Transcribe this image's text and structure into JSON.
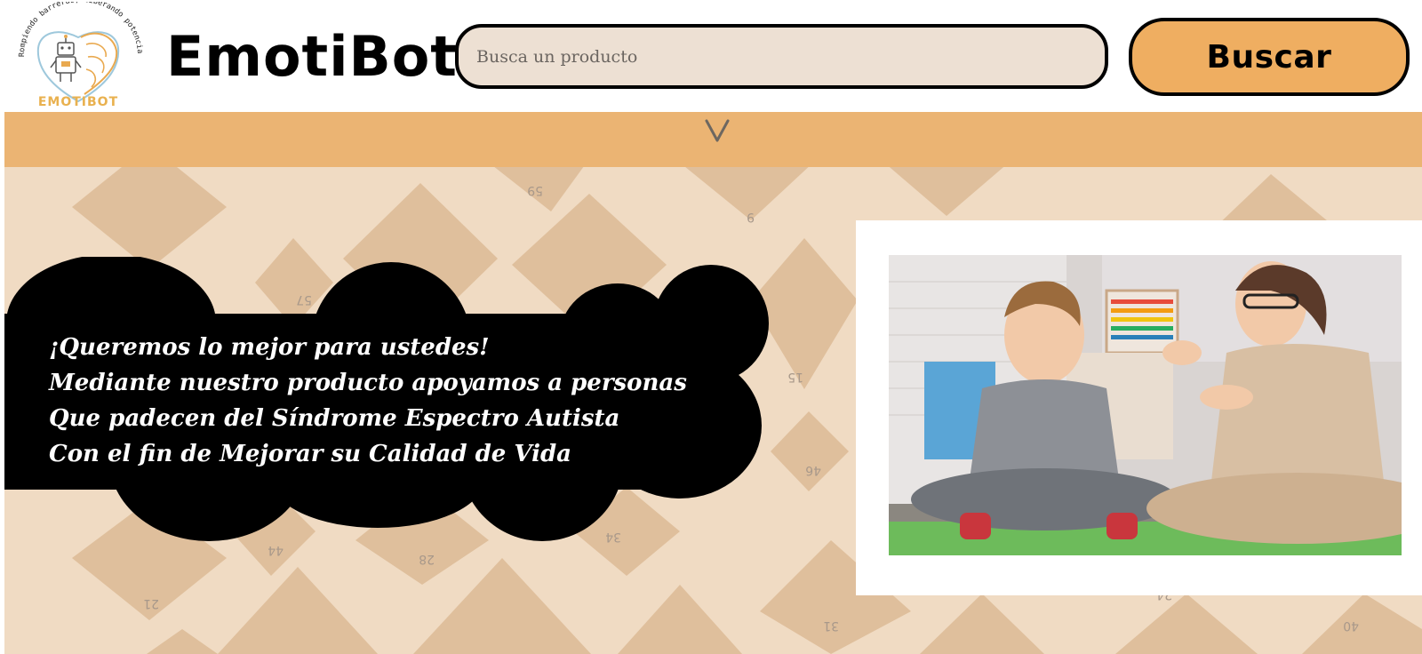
{
  "header": {
    "logo": {
      "arc_text": "Rompiendo barreras, liberando potencial",
      "name_text": "EMOTIBOT"
    },
    "brand_title": "EmotiBot",
    "search": {
      "placeholder": "Busca un producto",
      "value": ""
    },
    "search_button_label": "Buscar"
  },
  "nav": {
    "toggle_icon": "chevron-down-icon"
  },
  "hero": {
    "message_lines": [
      "¡Queremos lo mejor para ustedes!",
      "Mediante nuestro producto apoyamos a personas",
      "Que padecen del Síndrome Espectro Autista",
      "Con el fin de Mejorar su Calidad de Vida"
    ],
    "photo": {
      "description_icon": "child-therapist-photo"
    }
  },
  "colors": {
    "accent_orange": "#ebb473",
    "button_orange": "#efae61",
    "search_bg": "#ede0d3",
    "hero_bg": "#f0dbc3",
    "diamond": "#dfbf9c"
  }
}
